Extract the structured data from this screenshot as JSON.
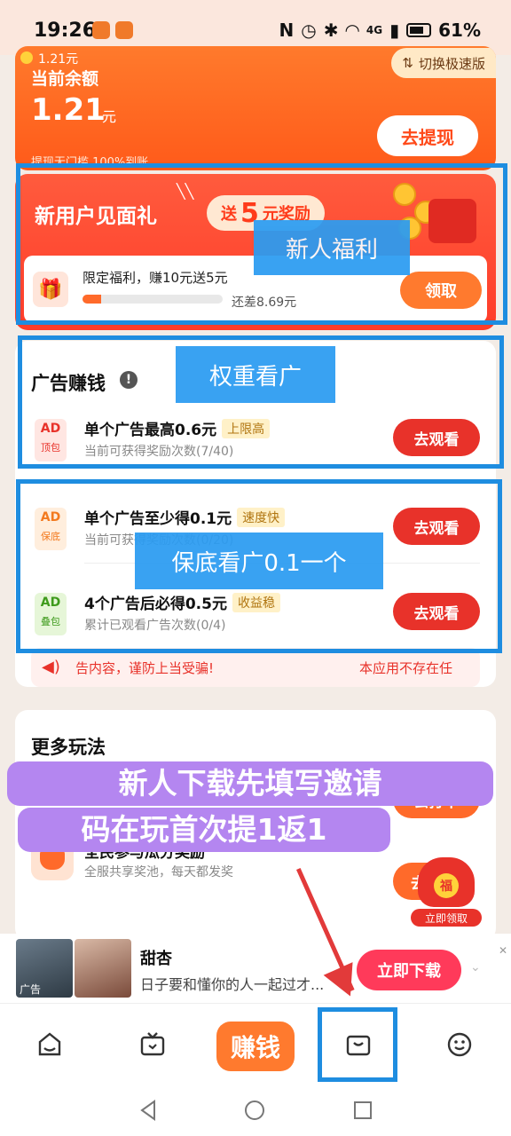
{
  "status_bar": {
    "time": "19:26",
    "network": "4G",
    "battery": "61%"
  },
  "balance": {
    "small_amount": "1.21元",
    "label": "当前余额",
    "value": "1.21",
    "unit": "元",
    "footer": "提现无门槛    100%到账",
    "switch_label": "切换极速版",
    "withdraw_label": "去提现"
  },
  "new_user": {
    "title": "新用户见面礼",
    "pill_pre": "送",
    "pill_num": "5",
    "pill_post": "元奖励",
    "limited": "限定福利，赚10元送5元",
    "progress": 0.13,
    "remaining": "还差8.69元",
    "claim_label": "领取"
  },
  "ads": {
    "title": "广告赚钱",
    "rows": [
      {
        "icon_top": "AD",
        "icon_sub": "顶包",
        "name": "单个广告最高0.6元",
        "tag": "上限高",
        "desc": "当前可获得奖励次数(7/40)",
        "btn": "去观看"
      },
      {
        "icon_top": "AD",
        "icon_sub": "保底",
        "name": "单个广告至少得0.1元",
        "tag": "速度快",
        "desc": "当前可获得奖励次数(0/20)",
        "btn": "去观看"
      },
      {
        "icon_top": "AD",
        "icon_sub": "叠包",
        "name": "4个广告后必得0.5元",
        "tag": "收益稳",
        "desc": "累计已观看广告次数(0/4)",
        "btn": "去观看"
      }
    ]
  },
  "notice": {
    "text": "告内容，谨防上当受骗!",
    "text2": "本应用不存在任"
  },
  "more": {
    "title": "更多玩法",
    "checkin_label": "去打卡",
    "pool_title": "全民参与瓜分奖励",
    "pool_desc": "全服共享奖池，每天都发奖",
    "pool_btn": "去",
    "bag_fu": "福",
    "bag_label": "立即领取"
  },
  "annotations": {
    "new_user_label": "新人福利",
    "weight_label": "权重看广",
    "floor_label": "保底看广0.1一个",
    "promo_line1": "新人下载先填写邀请",
    "promo_line2": "码在玩首次提1返1"
  },
  "ad_banner": {
    "badge": "广告",
    "title": "甜杏",
    "subtitle": "日子要和懂你的人一起过才...",
    "download_label": "立即下载"
  },
  "bottom_nav": {
    "center_label": "赚钱",
    "items": [
      "home-icon",
      "tv-icon",
      "earn-tab",
      "wallet-icon",
      "smile-icon"
    ]
  },
  "colors": {
    "accent": "#ff5a1a",
    "danger": "#e8322a",
    "annotation": "#1e8de0",
    "promo": "#b486f0"
  }
}
